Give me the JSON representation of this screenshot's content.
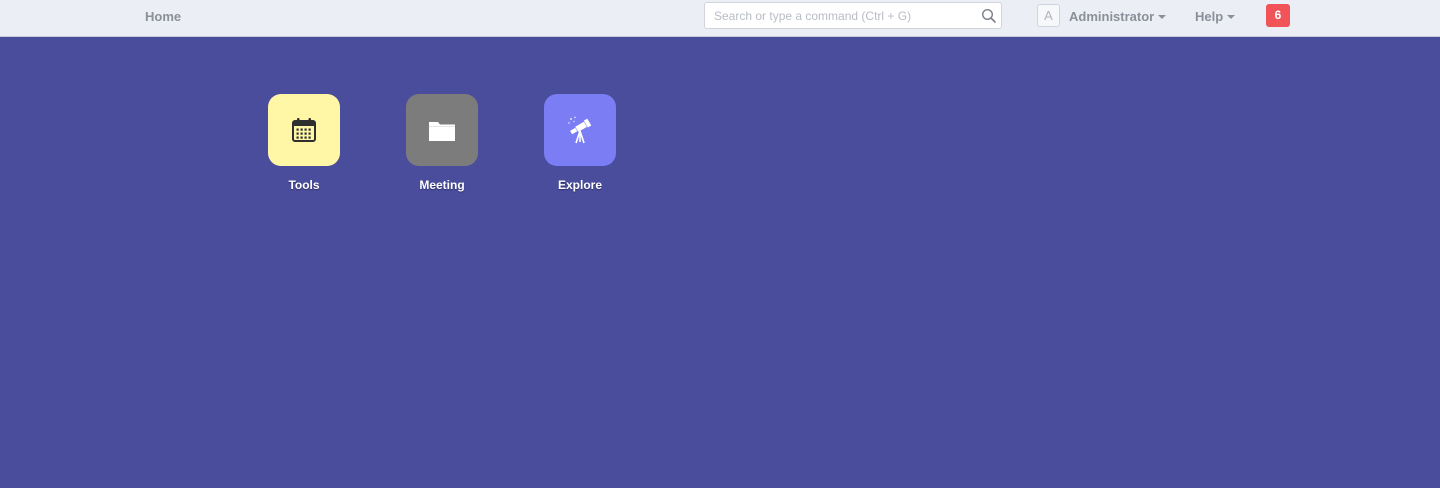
{
  "navbar": {
    "home_label": "Home",
    "search": {
      "placeholder": "Search or type a command (Ctrl + G)",
      "value": ""
    },
    "user": {
      "avatar_letter": "A",
      "name": "Administrator"
    },
    "help_label": "Help",
    "notification_count": "6"
  },
  "apps": [
    {
      "label": "Tools",
      "icon": "calendar-icon",
      "color": "#fff6a6"
    },
    {
      "label": "Meeting",
      "icon": "folder-icon",
      "color": "#7c7c7c"
    },
    {
      "label": "Explore",
      "icon": "telescope-icon",
      "color": "#7b7df5"
    }
  ],
  "colors": {
    "background": "#4a4c9c",
    "navbar": "#eceef6",
    "badge": "#f05458"
  }
}
